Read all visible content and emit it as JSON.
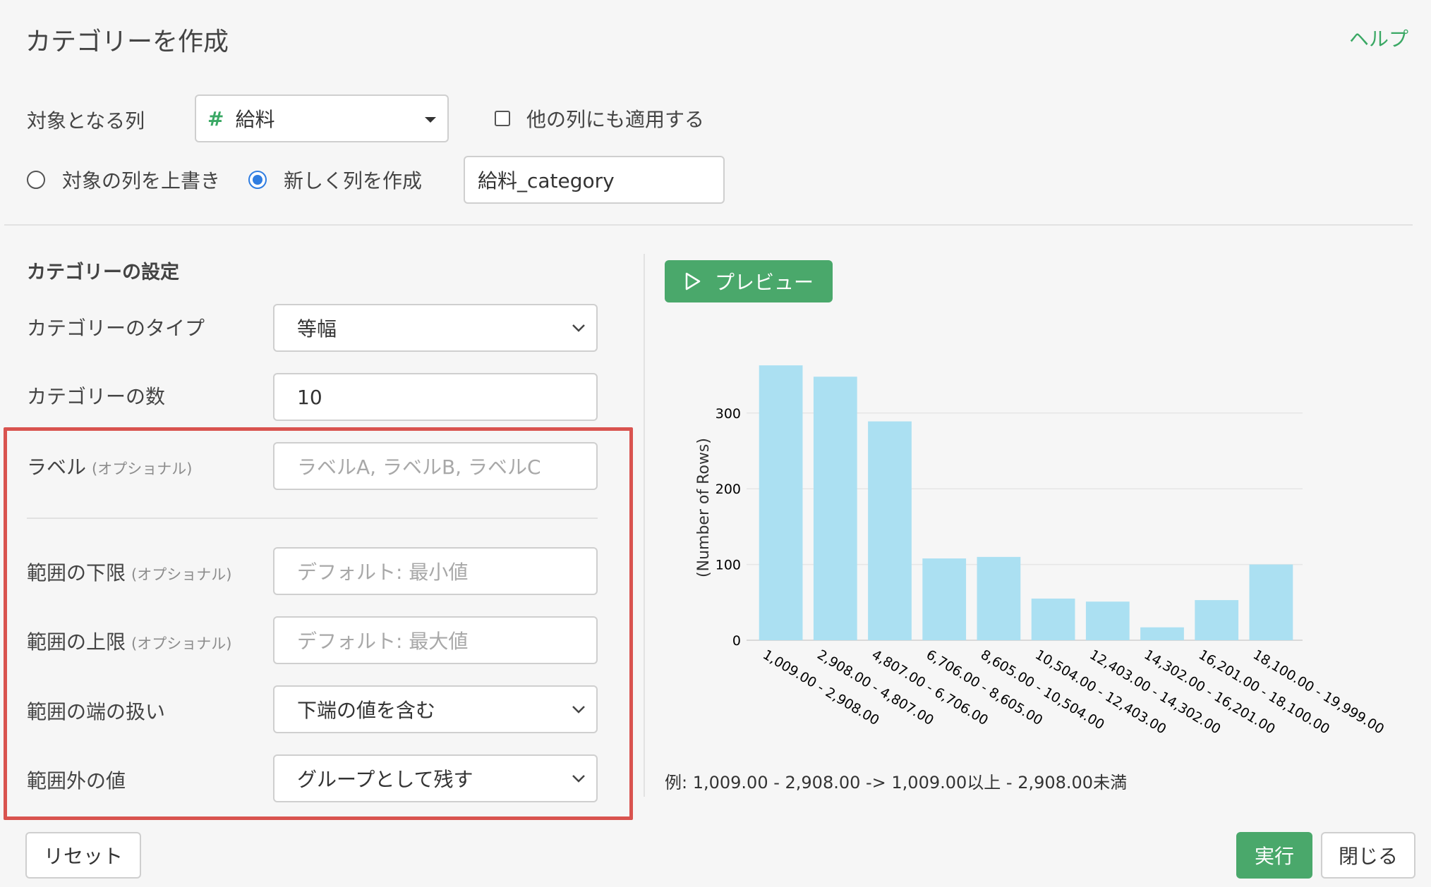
{
  "header": {
    "title": "カテゴリーを作成",
    "help": "ヘルプ"
  },
  "target": {
    "label": "対象となる列",
    "column_icon": "#",
    "column_value": "給料",
    "apply_other_label": "他の列にも適用する",
    "apply_other_checked": false
  },
  "output": {
    "overwrite_label": "対象の列を上書き",
    "new_column_label": "新しく列を作成",
    "selected": "new_column",
    "new_column_name": "給料_category"
  },
  "settings": {
    "heading": "カテゴリーの設定",
    "type_label": "カテゴリーのタイプ",
    "type_value": "等幅",
    "count_label": "カテゴリーの数",
    "count_value": "10",
    "labels_label": "ラベル",
    "labels_optional": "(オプショナル)",
    "labels_placeholder": "ラベルA, ラベルB, ラベルC",
    "lower_label": "範囲の下限",
    "lower_optional": "(オプショナル)",
    "lower_placeholder": "デフォルト: 最小値",
    "upper_label": "範囲の上限",
    "upper_optional": "(オプショナル)",
    "upper_placeholder": "デフォルト: 最大値",
    "edge_label": "範囲の端の扱い",
    "edge_value": "下端の値を含む",
    "outside_label": "範囲外の値",
    "outside_value": "グループとして残す"
  },
  "preview": {
    "button_label": "プレビュー"
  },
  "chart_data": {
    "type": "bar",
    "ylabel": "(Number of Rows)",
    "xlabel": "",
    "ylim": [
      0,
      365
    ],
    "yticks": [
      0,
      100,
      200,
      300
    ],
    "grid": true,
    "color": "#abe0f2",
    "categories": [
      "1,009.00 - 2,908.00",
      "2,908.00 - 4,807.00",
      "4,807.00 - 6,706.00",
      "6,706.00 - 8,605.00",
      "8,605.00 - 10,504.00",
      "10,504.00 - 12,403.00",
      "12,403.00 - 14,302.00",
      "14,302.00 - 16,201.00",
      "16,201.00 - 18,100.00",
      "18,100.00 - 19,999.00"
    ],
    "values": [
      363,
      348,
      289,
      108,
      110,
      55,
      51,
      17,
      53,
      100
    ]
  },
  "example_text": "例: 1,009.00 - 2,908.00 -> 1,009.00以上 - 2,908.00未満",
  "footer": {
    "reset_label": "リセット",
    "run_label": "実行",
    "close_label": "閉じる"
  }
}
